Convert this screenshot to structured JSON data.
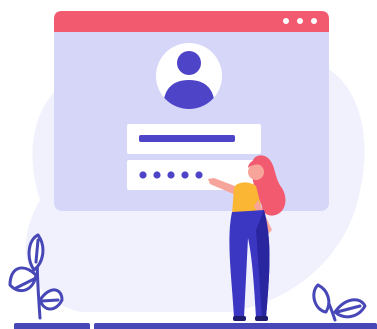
{
  "window": {
    "titlebar_dots": 3,
    "colors": {
      "titlebar": "#f25a6f",
      "window_bg": "#d6d6f9",
      "dot": "#ffffff"
    }
  },
  "avatar": {
    "icon": "user-icon",
    "colors": {
      "circle": "#ffffff",
      "figure": "#4e44c8"
    }
  },
  "login_form": {
    "username_field": {
      "value": ""
    },
    "password_field": {
      "masked_char_count": 5
    }
  },
  "illustration": {
    "person": "woman-pointing-at-password",
    "colors": {
      "hair": "#f25a6f",
      "top": "#fbb733",
      "pants": "#3b37c3",
      "skin": "#f7a59b",
      "background_blob": "#f1f1fd",
      "plant_stroke": "#4747b8",
      "floor": "#4747b8"
    },
    "plants": [
      "plant-left",
      "plant-right"
    ]
  }
}
